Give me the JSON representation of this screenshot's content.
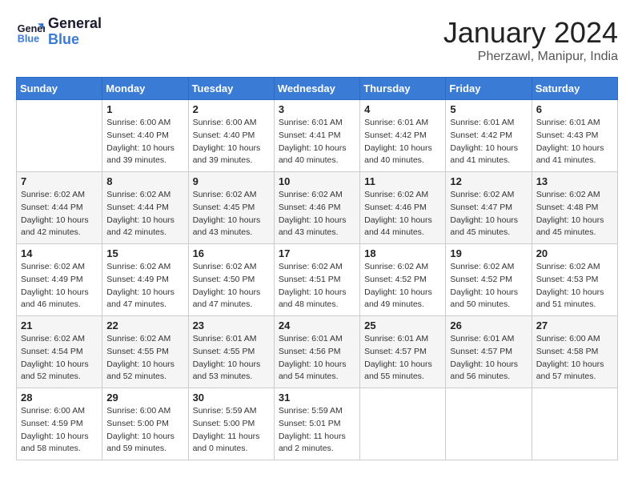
{
  "logo": {
    "line1": "General",
    "line2": "Blue"
  },
  "title": "January 2024",
  "subtitle": "Pherzawl, Manipur, India",
  "weekdays": [
    "Sunday",
    "Monday",
    "Tuesday",
    "Wednesday",
    "Thursday",
    "Friday",
    "Saturday"
  ],
  "weeks": [
    [
      {
        "day": "",
        "info": ""
      },
      {
        "day": "1",
        "info": "Sunrise: 6:00 AM\nSunset: 4:40 PM\nDaylight: 10 hours\nand 39 minutes."
      },
      {
        "day": "2",
        "info": "Sunrise: 6:00 AM\nSunset: 4:40 PM\nDaylight: 10 hours\nand 39 minutes."
      },
      {
        "day": "3",
        "info": "Sunrise: 6:01 AM\nSunset: 4:41 PM\nDaylight: 10 hours\nand 40 minutes."
      },
      {
        "day": "4",
        "info": "Sunrise: 6:01 AM\nSunset: 4:42 PM\nDaylight: 10 hours\nand 40 minutes."
      },
      {
        "day": "5",
        "info": "Sunrise: 6:01 AM\nSunset: 4:42 PM\nDaylight: 10 hours\nand 41 minutes."
      },
      {
        "day": "6",
        "info": "Sunrise: 6:01 AM\nSunset: 4:43 PM\nDaylight: 10 hours\nand 41 minutes."
      }
    ],
    [
      {
        "day": "7",
        "info": ""
      },
      {
        "day": "8",
        "info": "Sunrise: 6:02 AM\nSunset: 4:44 PM\nDaylight: 10 hours\nand 42 minutes."
      },
      {
        "day": "9",
        "info": "Sunrise: 6:02 AM\nSunset: 4:45 PM\nDaylight: 10 hours\nand 43 minutes."
      },
      {
        "day": "10",
        "info": "Sunrise: 6:02 AM\nSunset: 4:46 PM\nDaylight: 10 hours\nand 43 minutes."
      },
      {
        "day": "11",
        "info": "Sunrise: 6:02 AM\nSunset: 4:46 PM\nDaylight: 10 hours\nand 44 minutes."
      },
      {
        "day": "12",
        "info": "Sunrise: 6:02 AM\nSunset: 4:47 PM\nDaylight: 10 hours\nand 45 minutes."
      },
      {
        "day": "13",
        "info": "Sunrise: 6:02 AM\nSunset: 4:48 PM\nDaylight: 10 hours\nand 45 minutes."
      }
    ],
    [
      {
        "day": "14",
        "info": ""
      },
      {
        "day": "15",
        "info": "Sunrise: 6:02 AM\nSunset: 4:49 PM\nDaylight: 10 hours\nand 47 minutes."
      },
      {
        "day": "16",
        "info": "Sunrise: 6:02 AM\nSunset: 4:50 PM\nDaylight: 10 hours\nand 47 minutes."
      },
      {
        "day": "17",
        "info": "Sunrise: 6:02 AM\nSunset: 4:51 PM\nDaylight: 10 hours\nand 48 minutes."
      },
      {
        "day": "18",
        "info": "Sunrise: 6:02 AM\nSunset: 4:52 PM\nDaylight: 10 hours\nand 49 minutes."
      },
      {
        "day": "19",
        "info": "Sunrise: 6:02 AM\nSunset: 4:52 PM\nDaylight: 10 hours\nand 50 minutes."
      },
      {
        "day": "20",
        "info": "Sunrise: 6:02 AM\nSunset: 4:53 PM\nDaylight: 10 hours\nand 51 minutes."
      }
    ],
    [
      {
        "day": "21",
        "info": ""
      },
      {
        "day": "22",
        "info": "Sunrise: 6:02 AM\nSunset: 4:55 PM\nDaylight: 10 hours\nand 52 minutes."
      },
      {
        "day": "23",
        "info": "Sunrise: 6:01 AM\nSunset: 4:55 PM\nDaylight: 10 hours\nand 53 minutes."
      },
      {
        "day": "24",
        "info": "Sunrise: 6:01 AM\nSunset: 4:56 PM\nDaylight: 10 hours\nand 54 minutes."
      },
      {
        "day": "25",
        "info": "Sunrise: 6:01 AM\nSunset: 4:57 PM\nDaylight: 10 hours\nand 55 minutes."
      },
      {
        "day": "26",
        "info": "Sunrise: 6:01 AM\nSunset: 4:57 PM\nDaylight: 10 hours\nand 56 minutes."
      },
      {
        "day": "27",
        "info": "Sunrise: 6:00 AM\nSunset: 4:58 PM\nDaylight: 10 hours\nand 57 minutes."
      }
    ],
    [
      {
        "day": "28",
        "info": "Sunrise: 6:00 AM\nSunset: 4:59 PM\nDaylight: 10 hours\nand 58 minutes."
      },
      {
        "day": "29",
        "info": "Sunrise: 6:00 AM\nSunset: 5:00 PM\nDaylight: 10 hours\nand 59 minutes."
      },
      {
        "day": "30",
        "info": "Sunrise: 5:59 AM\nSunset: 5:00 PM\nDaylight: 11 hours\nand 0 minutes."
      },
      {
        "day": "31",
        "info": "Sunrise: 5:59 AM\nSunset: 5:01 PM\nDaylight: 11 hours\nand 2 minutes."
      },
      {
        "day": "",
        "info": ""
      },
      {
        "day": "",
        "info": ""
      },
      {
        "day": "",
        "info": ""
      }
    ]
  ],
  "week14_sunday": "Sunrise: 6:02 AM\nSunset: 4:49 PM\nDaylight: 10 hours\nand 46 minutes.",
  "week21_sunday": "Sunrise: 6:02 AM\nSunset: 4:54 PM\nDaylight: 10 hours\nand 52 minutes.",
  "week7_sunday": "Sunrise: 6:02 AM\nSunset: 4:44 PM\nDaylight: 10 hours\nand 42 minutes."
}
